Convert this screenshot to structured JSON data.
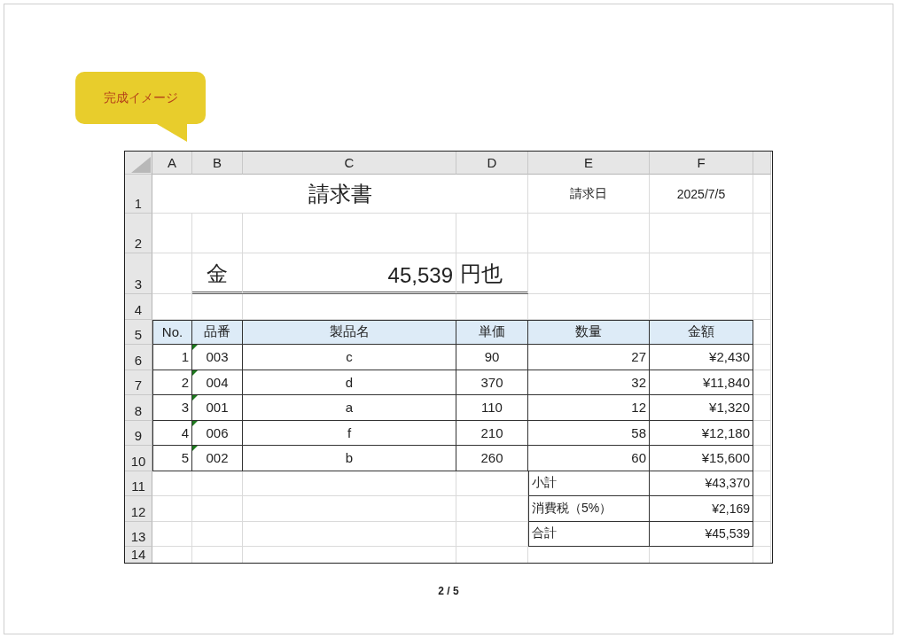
{
  "callout": {
    "text": "完成イメージ"
  },
  "spreadsheet": {
    "columns": [
      "A",
      "B",
      "C",
      "D",
      "E",
      "F"
    ],
    "rows": [
      {
        "number": "1",
        "kind": "title",
        "title": "請求書",
        "date_label": "請求日",
        "date": "2025/7/5"
      },
      {
        "number": "2",
        "kind": "blank"
      },
      {
        "number": "3",
        "kind": "amount",
        "prefix": "金",
        "amount": "45,539",
        "unit": "円也"
      },
      {
        "number": "4",
        "kind": "blank"
      },
      {
        "number": "5",
        "kind": "table-header",
        "cells": [
          "No.",
          "品番",
          "製品名",
          "単価",
          "数量",
          "金額"
        ]
      },
      {
        "number": "6",
        "kind": "item",
        "flagged": true,
        "cells": [
          "1",
          "003",
          "c",
          "90",
          "27",
          "¥2,430"
        ]
      },
      {
        "number": "7",
        "kind": "item",
        "flagged": true,
        "cells": [
          "2",
          "004",
          "d",
          "370",
          "32",
          "¥11,840"
        ]
      },
      {
        "number": "8",
        "kind": "item",
        "flagged": true,
        "cells": [
          "3",
          "001",
          "a",
          "110",
          "12",
          "¥1,320"
        ]
      },
      {
        "number": "9",
        "kind": "item",
        "flagged": true,
        "cells": [
          "4",
          "006",
          "f",
          "210",
          "58",
          "¥12,180"
        ]
      },
      {
        "number": "10",
        "kind": "item",
        "flagged": true,
        "cells": [
          "5",
          "002",
          "b",
          "260",
          "60",
          "¥15,600"
        ]
      },
      {
        "number": "11",
        "kind": "summary",
        "label": "小計",
        "value": "¥43,370"
      },
      {
        "number": "12",
        "kind": "summary",
        "label": "消費税（5%）",
        "value": "¥2,169"
      },
      {
        "number": "13",
        "kind": "summary",
        "label": "合計",
        "value": "¥45,539"
      },
      {
        "number": "14",
        "kind": "partial"
      }
    ]
  },
  "page_indicator": "2 / 5"
}
